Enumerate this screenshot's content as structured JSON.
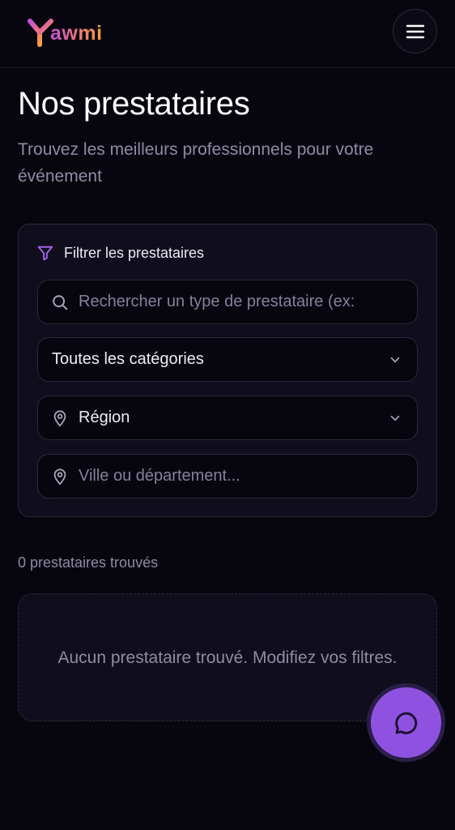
{
  "header": {
    "logo_text": "awmi",
    "logo_colors": {
      "start": "#c44fd6",
      "mid": "#e9708a",
      "end": "#f4a23c"
    },
    "menu_icon": "hamburger-menu-icon"
  },
  "page": {
    "title": "Nos prestataires",
    "subtitle": "Trouvez les meilleurs professionnels pour votre événement"
  },
  "filters": {
    "heading": "Filtrer les prestataires",
    "heading_icon": "filter-icon",
    "search": {
      "placeholder": "Rechercher un type de prestataire (ex:",
      "icon": "search-icon"
    },
    "category": {
      "selected": "Toutes les catégories",
      "icon": "chevron-down-icon"
    },
    "region": {
      "selected": "Région",
      "icon": "map-pin-icon"
    },
    "city": {
      "placeholder": "Ville ou département...",
      "icon": "map-pin-icon"
    }
  },
  "results": {
    "count_text": "0 prestataires trouvés",
    "empty_message": "Aucun prestataire trouvé. Modifiez vos filtres."
  },
  "chat": {
    "icon": "chat-bubble-icon",
    "color": "#8f52e0"
  },
  "colors": {
    "background": "#07060f",
    "accent": "#9b59f0",
    "card": "#100e1c"
  }
}
